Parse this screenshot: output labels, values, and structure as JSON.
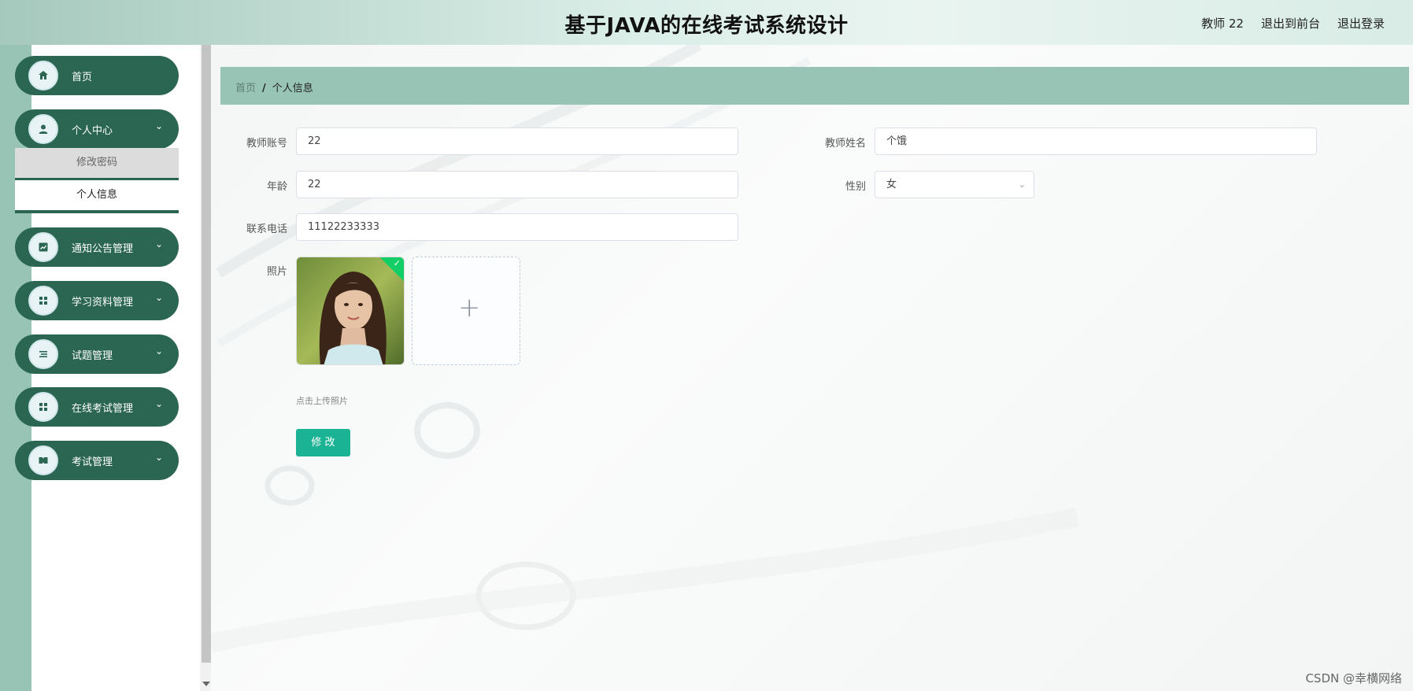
{
  "header": {
    "title": "基于JAVA的在线考试系统设计",
    "user": "教师 22",
    "back_front": "退出到前台",
    "logout": "退出登录"
  },
  "sidebar": {
    "items": [
      {
        "label": "首页",
        "icon": "home-icon"
      },
      {
        "label": "个人中心",
        "icon": "user-icon"
      },
      {
        "label": "通知公告管理",
        "icon": "chart-icon"
      },
      {
        "label": "学习资料管理",
        "icon": "grid-icon"
      },
      {
        "label": "试题管理",
        "icon": "list-icon"
      },
      {
        "label": "在线考试管理",
        "icon": "grid-icon"
      },
      {
        "label": "考试管理",
        "icon": "ticket-icon"
      }
    ],
    "submenu": [
      "修改密码",
      "个人信息"
    ]
  },
  "breadcrumb": {
    "home": "首页",
    "separator": "/",
    "current": "个人信息"
  },
  "form": {
    "account_label": "教师账号",
    "account_value": "22",
    "name_label": "教师姓名",
    "name_value": "个饿",
    "age_label": "年龄",
    "age_value": "22",
    "gender_label": "性别",
    "gender_value": "女",
    "phone_label": "联系电话",
    "phone_value": "11122233333",
    "photo_label": "照片",
    "upload_hint": "点击上传照片",
    "submit": "修 改"
  },
  "watermark": "CSDN @幸横网络",
  "colors": {
    "sidebar_item": "#2a6651",
    "breadcrumb_bg": "#98c4b6",
    "button": "#1ab394"
  }
}
